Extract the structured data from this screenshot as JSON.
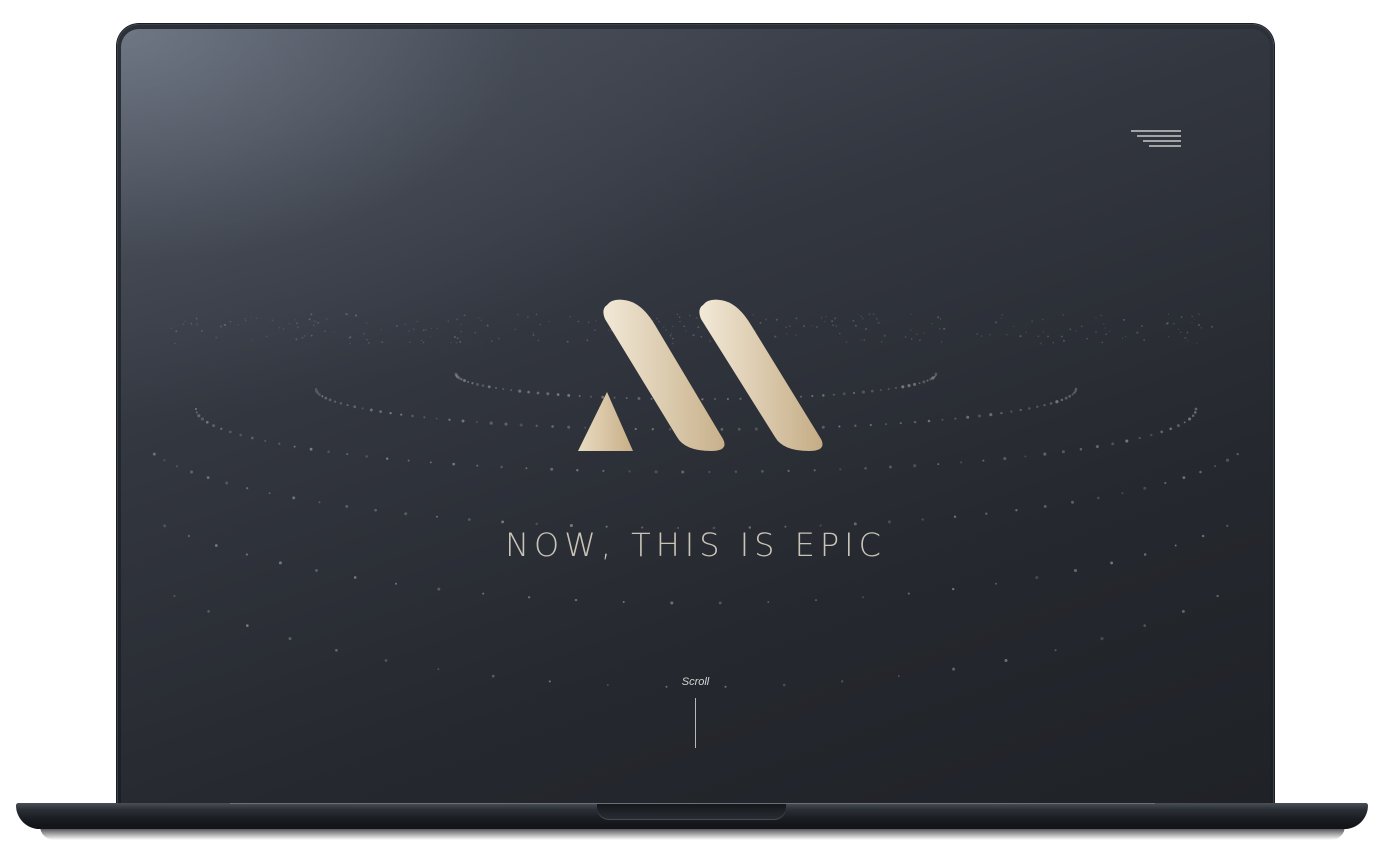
{
  "hero": {
    "tagline": "NOW, THIS IS EPIC"
  },
  "scroll": {
    "label": "Scroll"
  },
  "icons": {
    "menu": "hamburger-menu-icon",
    "logo": "gold-m-logo"
  },
  "colors": {
    "accent_gold_light": "#efe5d0",
    "accent_gold_dark": "#c3ab84",
    "tagline": "#c9c4b8",
    "screen_dark": "#1f2227"
  }
}
